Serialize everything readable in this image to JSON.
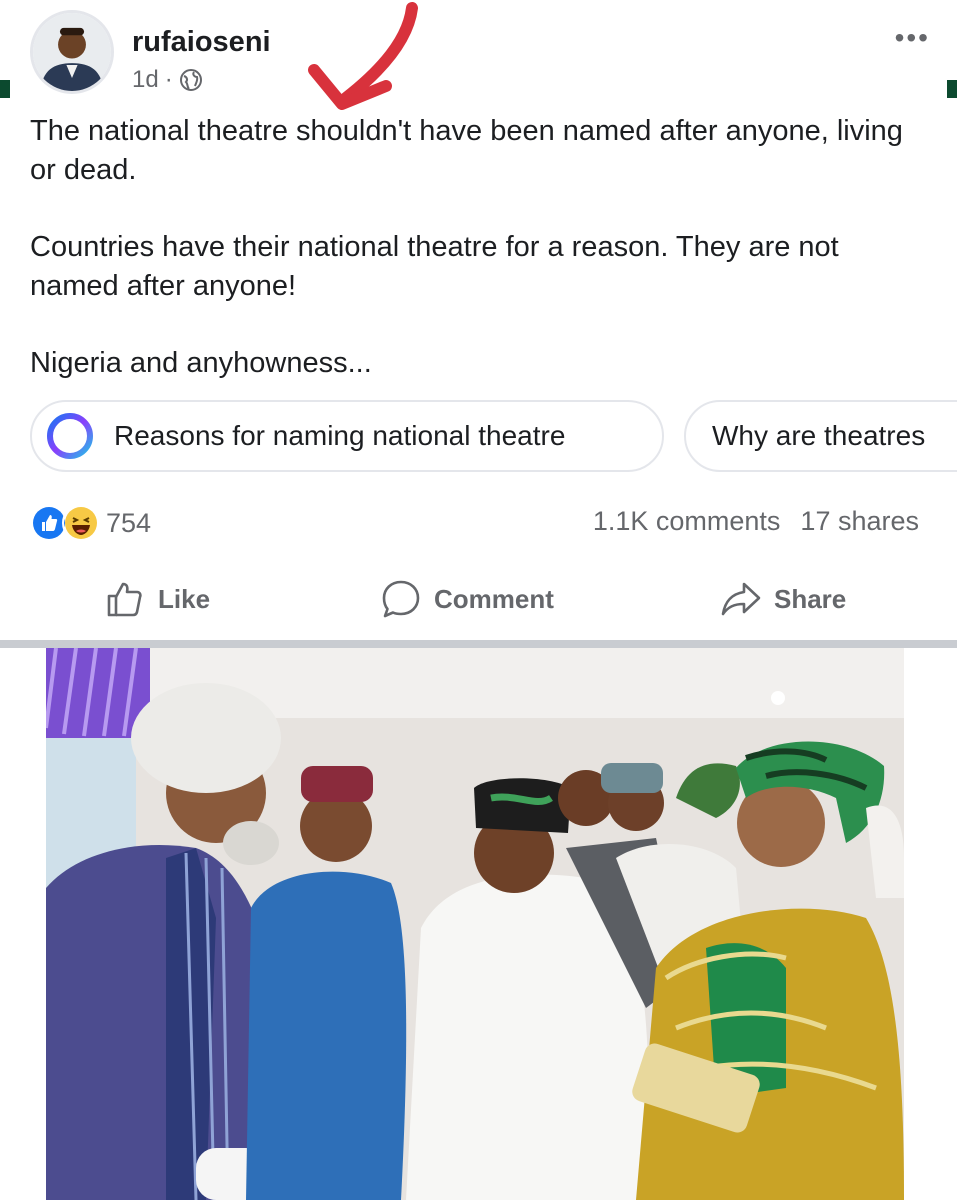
{
  "post": {
    "author": "rufaioseni",
    "time": "1d",
    "dot": "·",
    "more": "•••",
    "paragraphs": [
      "The national theatre shouldn't have been named after anyone, living or dead.",
      "Countries have their national theatre for a reason. They are not named after anyone!",
      "Nigeria and anyhowness..."
    ]
  },
  "suggestions": [
    "Reasons for naming national theatre",
    "Why are theatres"
  ],
  "engagement": {
    "reactions_count": "754",
    "comments": "1.1K comments",
    "shares": "17 shares"
  },
  "actions": {
    "like": "Like",
    "comment": "Comment",
    "share": "Share"
  },
  "colors": {
    "accent": "#1877f2",
    "annotation_arrow": "#d8323c",
    "edge_mark": "#0c4a2f"
  },
  "icons": [
    "globe-icon",
    "more-icon",
    "ai-ring-icon",
    "like-reaction-icon",
    "haha-reaction-icon",
    "thumbs-up-icon",
    "comment-icon",
    "share-icon"
  ]
}
